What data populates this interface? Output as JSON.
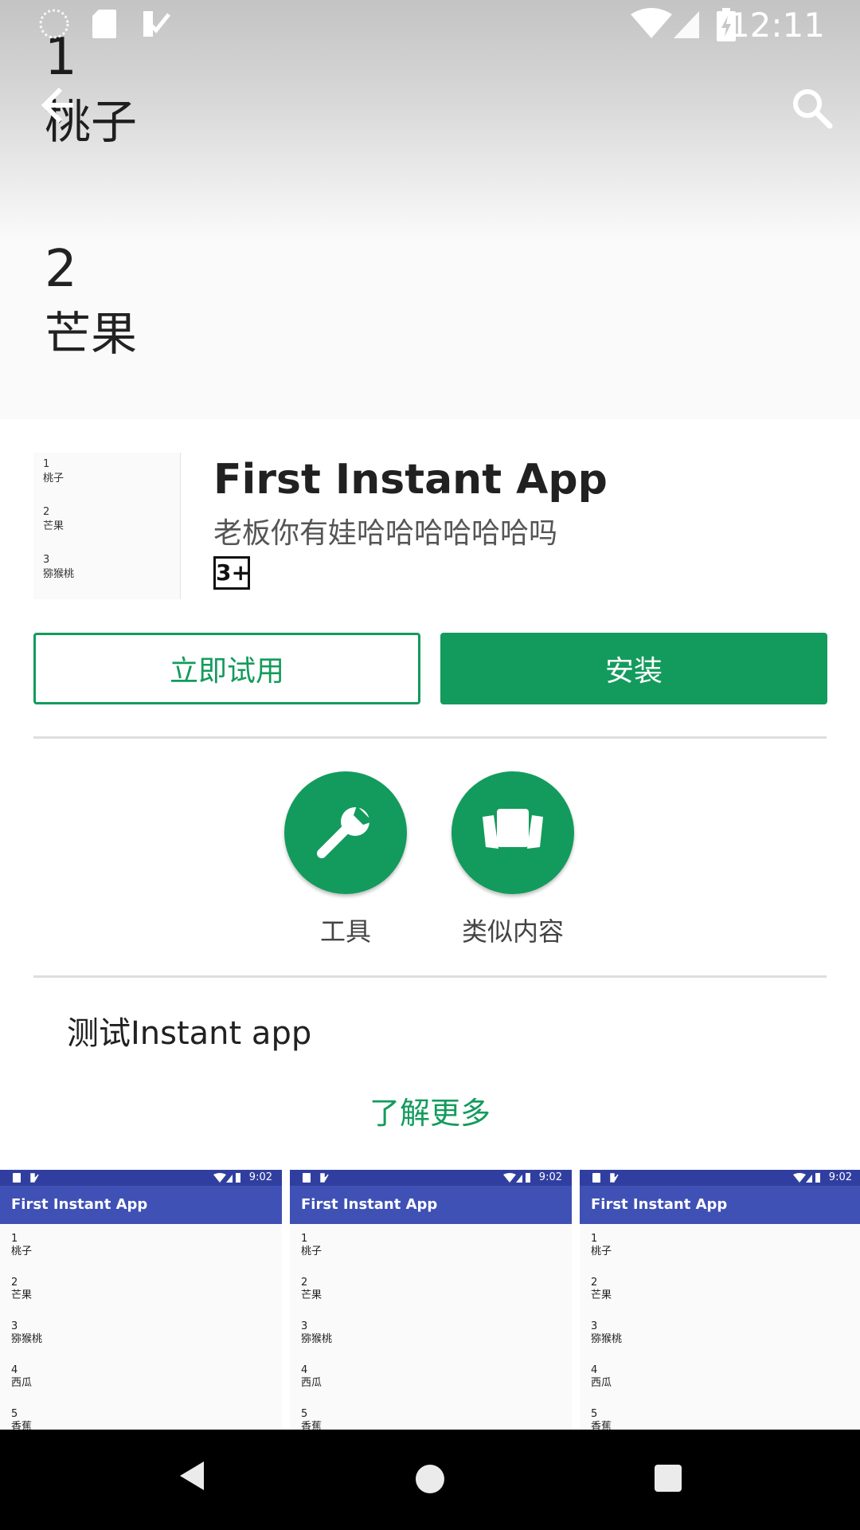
{
  "status_bar": {
    "time": "12:11"
  },
  "feature_graphic": {
    "items": [
      {
        "number": "1",
        "fruit": "桃子"
      },
      {
        "number": "2",
        "fruit": "芒果"
      }
    ]
  },
  "app": {
    "title": "First Instant App",
    "subtitle": "老板你有娃哈哈哈哈哈哈吗",
    "rating": "3+",
    "icon_items": [
      {
        "number": "1",
        "fruit": "桃子"
      },
      {
        "number": "2",
        "fruit": "芒果"
      },
      {
        "number": "3",
        "fruit": "猕猴桃"
      }
    ]
  },
  "buttons": {
    "try_now": "立即试用",
    "install": "安装"
  },
  "categories": [
    {
      "label": "工具",
      "icon": "wrench-icon"
    },
    {
      "label": "类似内容",
      "icon": "cards-icon"
    }
  ],
  "description": "测试Instant app",
  "learn_more": "了解更多",
  "screenshot": {
    "time": "9:02",
    "toolbar_title": "First Instant App",
    "items": [
      {
        "number": "1",
        "fruit": "桃子"
      },
      {
        "number": "2",
        "fruit": "芒果"
      },
      {
        "number": "3",
        "fruit": "猕猴桃"
      },
      {
        "number": "4",
        "fruit": "西瓜"
      },
      {
        "number": "5",
        "fruit": "香蕉"
      }
    ]
  },
  "colors": {
    "accent": "#139b5d",
    "screenshot_toolbar": "#3f51b5",
    "screenshot_statusbar": "#303f9f"
  }
}
